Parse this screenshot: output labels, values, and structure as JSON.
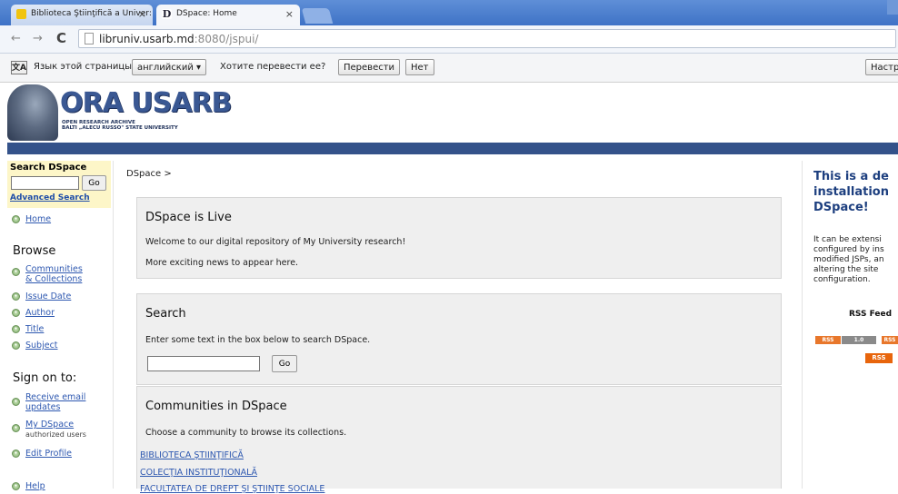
{
  "browser": {
    "tabs": [
      {
        "label": "Biblioteca Ştiinţifică a Univer:"
      },
      {
        "label": "DSpace: Home",
        "icon_glyph": "D"
      }
    ],
    "url_main": "libruniv.usarb.md",
    "url_rest": ":8080/jspui/",
    "translate": {
      "prompt": "Язык этой страницы",
      "language": "английский ▾",
      "question": "Хотите перевести ее?",
      "translate_btn": "Перевести",
      "no_btn": "Нет",
      "settings": "Настр"
    }
  },
  "header": {
    "logo": "ORA USARB",
    "subtitle1": "OPEN RESEARCH ARCHIVE",
    "subtitle2": "BALTI „ALECU RUSSO\" STATE UNIVERSITY"
  },
  "sidebar": {
    "search_title": "Search DSpace",
    "go": "Go",
    "advanced": "Advanced Search",
    "home": "Home",
    "browse_heading": "Browse",
    "browse": {
      "communities_1": "Communities",
      "communities_2": "& Collections",
      "issue_date": "Issue Date",
      "author": "Author",
      "title": "Title",
      "subject": "Subject"
    },
    "signon_heading": "Sign on to:",
    "signon": {
      "receive_1": "Receive email",
      "receive_2": "updates",
      "mydspace": "My DSpace",
      "mydspace_note": "authorized users",
      "edit_profile": "Edit Profile"
    },
    "help": "Help"
  },
  "main": {
    "breadcrumb": "DSpace >",
    "live": {
      "title": "DSpace is Live",
      "line1": "Welcome to our digital repository of My University research!",
      "line2": "More exciting news to appear here."
    },
    "search": {
      "title": "Search",
      "text": "Enter some text in the box below to search DSpace.",
      "go": "Go"
    },
    "communities": {
      "title": "Communities in DSpace",
      "text": "Choose a community to browse its collections.",
      "links": [
        "BIBLIOTECA ŞTIINŢIFICĂ",
        "COLECŢIA INSTITUŢIONALĂ",
        "FACULTATEA DE DREPT ŞI ŞTIINŢE SOCIALE"
      ]
    }
  },
  "right": {
    "title1": "This is a de",
    "title2": "installation",
    "title3": "DSpace!",
    "text1": "It can be extensi",
    "text2": "configured by ins",
    "text3": "modified JSPs, an",
    "text4": "altering the site",
    "text5": "configuration.",
    "rss_label": "RSS Feed",
    "rss_badges": [
      "RSS",
      "1.0",
      "RSS",
      "RSS"
    ]
  }
}
